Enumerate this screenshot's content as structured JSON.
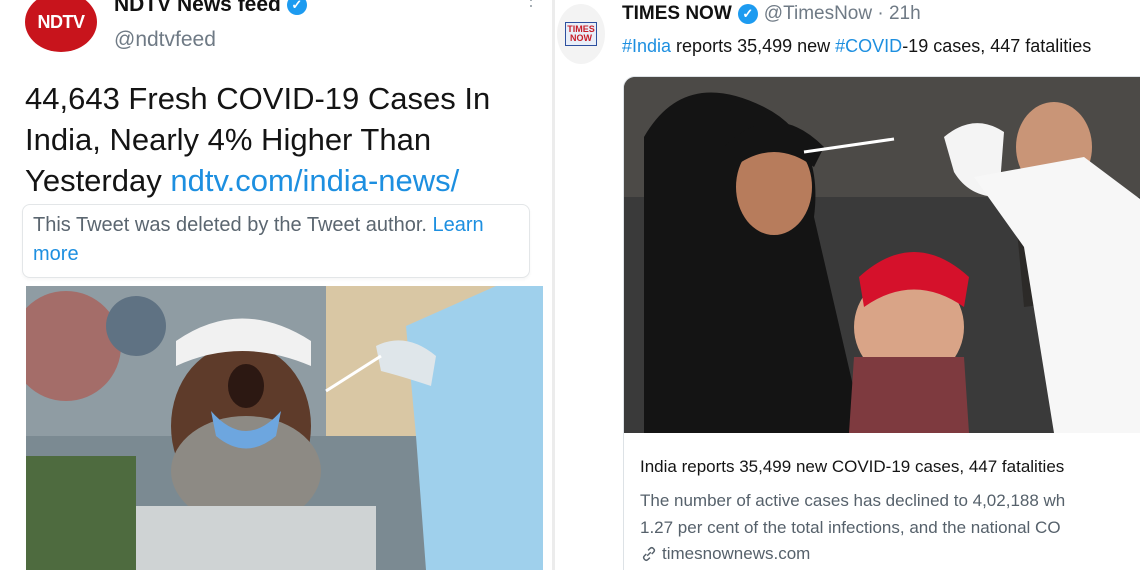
{
  "left_tweet": {
    "avatar_logo": "NDTV",
    "display_name": "NDTV News feed",
    "handle": "@ndtvfeed",
    "headline_text": "44,643 Fresh COVID-19 Cases In India, Nearly 4% Higher Than Yesterday",
    "headline_link": "ndtv.com/india-news/",
    "deleted_notice": "This Tweet was deleted by the Tweet author.",
    "learn_more": "Learn more",
    "more_icon": "more-vertical-icon",
    "verified_icon": "verified-badge-icon"
  },
  "right_tweet": {
    "avatar_logo_line1": "TIMES",
    "avatar_logo_line2": "NOW",
    "display_name": "TIMES NOW",
    "handle_time": "@TimesNow · 21h",
    "text_parts": {
      "hashtag_india": "#India",
      "text1": " reports 35,499 new ",
      "hashtag_covid": "#COVID",
      "text2": "-19 cases, 447 fatalities"
    },
    "card": {
      "title": "India reports 35,499 new COVID-19 cases, 447 fatalities",
      "description_line1": "The number of active cases has declined to 4,02,188 wh",
      "description_line2": "1.27 per cent of the total infections, and the national CO",
      "domain": "timesnownews.com",
      "link_icon": "link-icon"
    }
  },
  "colors": {
    "ndtv_red": "#c8141c",
    "link_blue": "#1d8fe0",
    "verified_blue": "#1d9bf0",
    "muted_gray": "#6f7a85"
  }
}
